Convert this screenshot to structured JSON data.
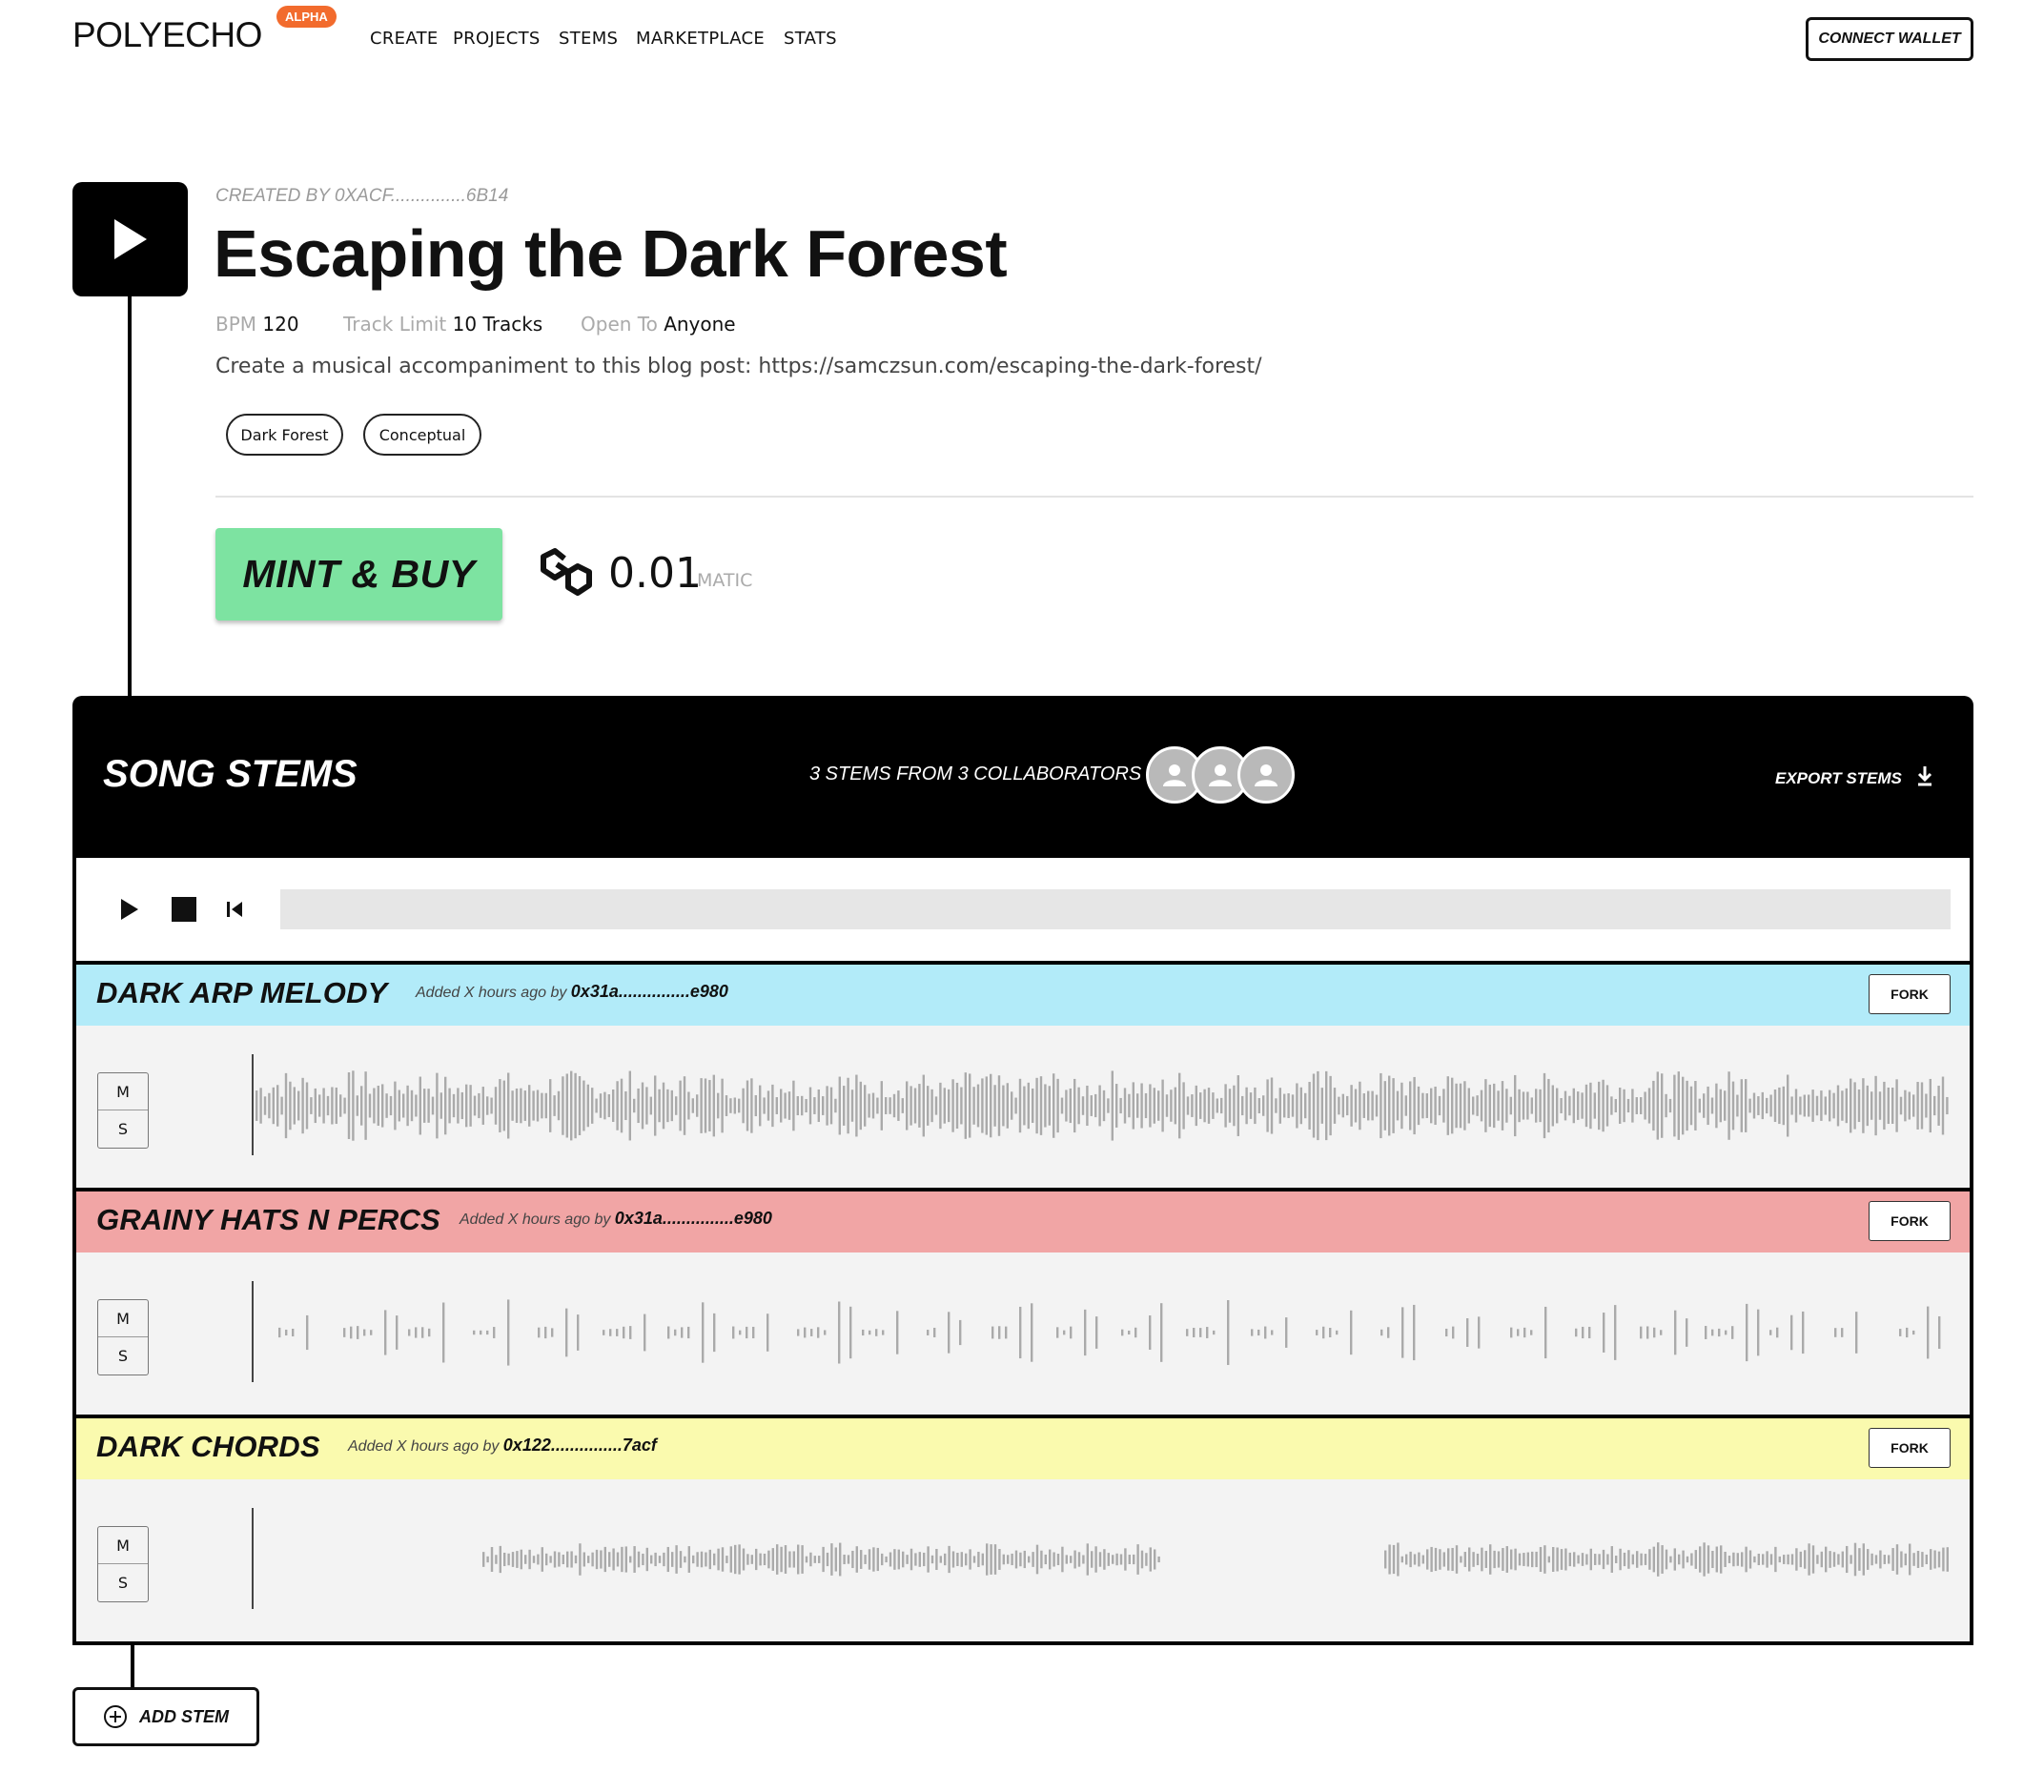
{
  "header": {
    "logo": "POLYECHO",
    "badge": "ALPHA",
    "nav": [
      "CREATE",
      "PROJECTS",
      "STEMS",
      "MARKETPLACE",
      "STATS"
    ],
    "connect_wallet": "CONNECT WALLET"
  },
  "project": {
    "created_by": "CREATED BY 0XACF...............6B14",
    "title": "Escaping the Dark Forest",
    "meta": [
      {
        "label": "BPM",
        "value": "120"
      },
      {
        "label": "Track Limit",
        "value": "10 Tracks"
      },
      {
        "label": "Open To",
        "value": "Anyone"
      }
    ],
    "description": "Create a musical accompaniment to this blog post: https://samczsun.com/escaping-the-dark-forest/",
    "tags": [
      "Dark Forest",
      "Conceptual"
    ],
    "mint_button": "MINT & BUY",
    "price": "0.01",
    "currency": "MATIC"
  },
  "stems": {
    "title": "SONG STEMS",
    "collaborators_text": "3 STEMS FROM 3 COLLABORATORS",
    "export_label": "EXPORT STEMS",
    "tracks": [
      {
        "name": "DARK ARP MELODY",
        "added": "Added X hours ago by",
        "author": "0x31a...............e980",
        "color": "#b2ebf9",
        "fork": "FORK",
        "mute": "M",
        "solo": "S"
      },
      {
        "name": "GRAINY HATS N PERCS",
        "added": "Added X hours ago by",
        "author": "0x31a...............e980",
        "color": "#f1a5a5",
        "fork": "FORK",
        "mute": "M",
        "solo": "S"
      },
      {
        "name": "DARK CHORDS",
        "added": "Added X hours ago by",
        "author": "0x122...............7acf",
        "color": "#fafaae",
        "fork": "FORK",
        "mute": "M",
        "solo": "S"
      }
    ],
    "add_stem": "ADD STEM"
  }
}
